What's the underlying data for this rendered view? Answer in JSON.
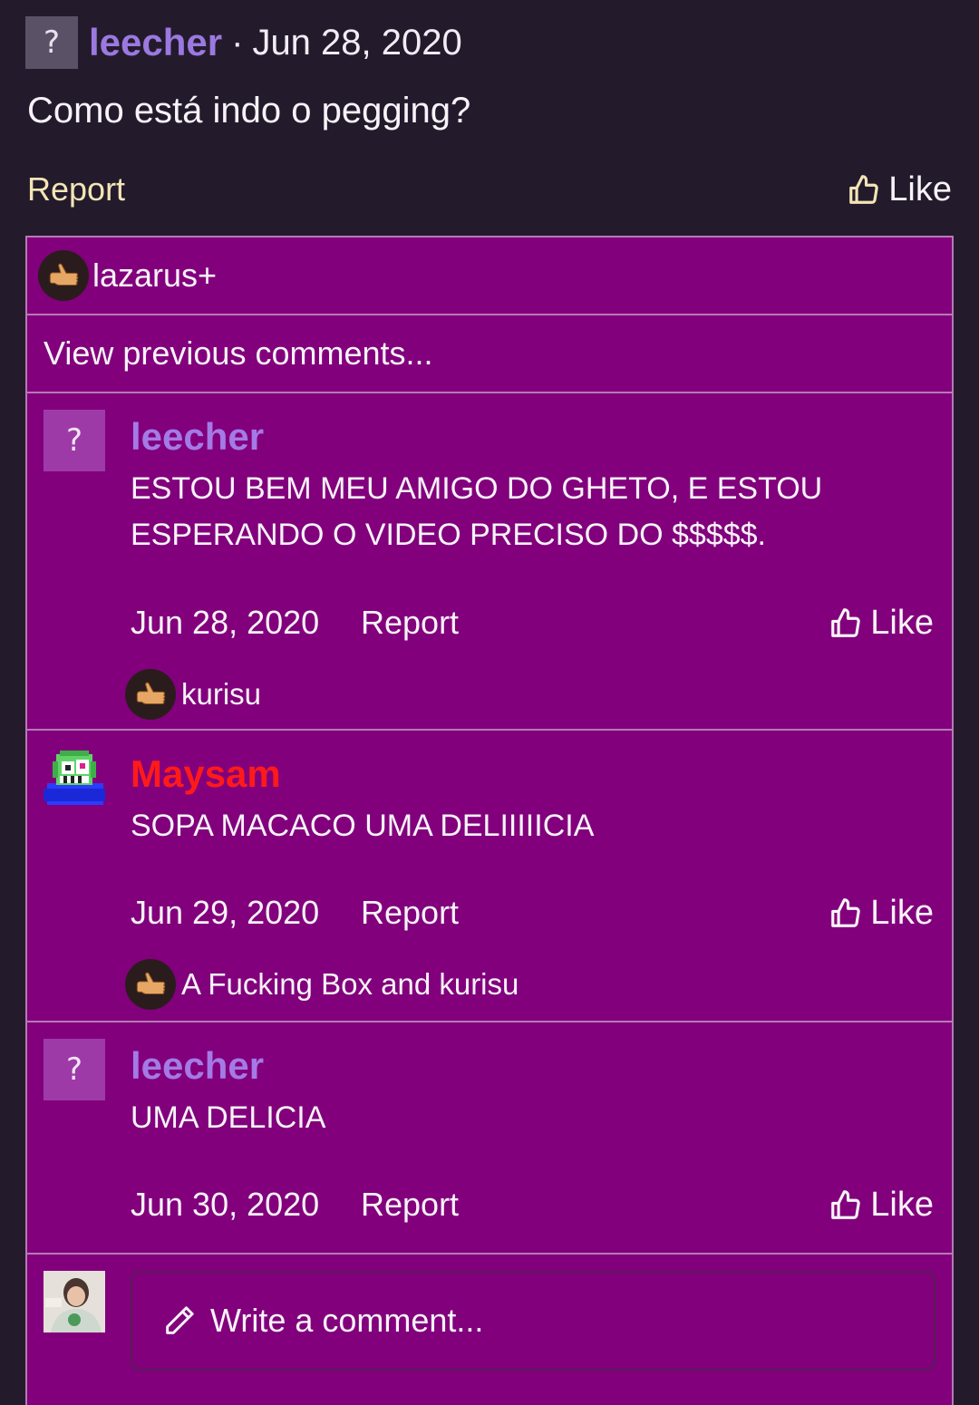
{
  "post": {
    "author": "leecher",
    "separator": "·",
    "date": "Jun 28, 2020",
    "body": "Como está indo o pegging?",
    "report_label": "Report",
    "like_label": "Like",
    "avatar_glyph": "?"
  },
  "comments_section": {
    "post_likers": "lazarus+",
    "view_previous_label": "View previous comments...",
    "comments": [
      {
        "author": "leecher",
        "author_color": "#a47ae6",
        "avatar_glyph": "?",
        "text": "ESTOU BEM MEU AMIGO DO GHETO, E ESTOU ESPERANDO O VIDEO PRECISO DO $$$$$.",
        "date": "Jun 28, 2020",
        "report_label": "Report",
        "like_label": "Like",
        "likers": "kurisu"
      },
      {
        "author": "Maysam",
        "author_color": "#ff1a1a",
        "avatar_icon": "pixel-creature-avatar",
        "text": "SOPA MACACO UMA DELIIIIICIA",
        "date": "Jun 29, 2020",
        "report_label": "Report",
        "like_label": "Like",
        "likers": "A Fucking Box and kurisu"
      },
      {
        "author": "leecher",
        "author_color": "#a47ae6",
        "avatar_glyph": "?",
        "text": "UMA DELICIA",
        "date": "Jun 30, 2020",
        "report_label": "Report",
        "like_label": "Like"
      }
    ],
    "write_placeholder": "Write a comment..."
  },
  "colors": {
    "page_bg": "#231b2c",
    "comments_bg": "#82007c",
    "username_purple": "#9b79e0",
    "report_yellow": "#f3e5b5"
  },
  "icons": [
    "thumbs-up-icon",
    "thumbs-up-emoji-icon",
    "pencil-icon"
  ]
}
